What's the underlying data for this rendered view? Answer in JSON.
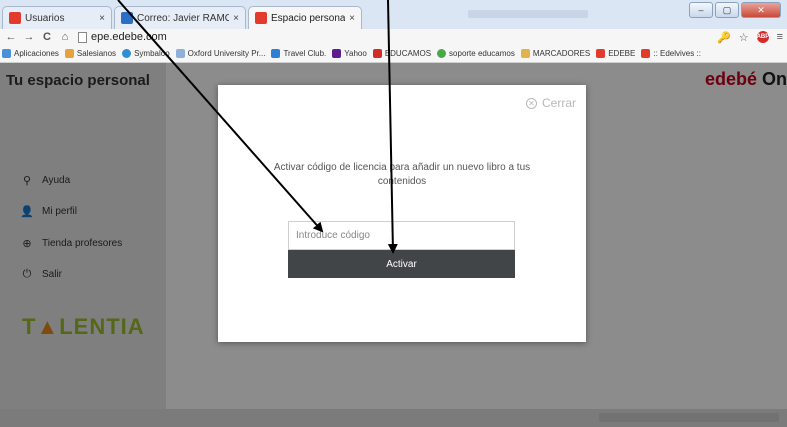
{
  "browser": {
    "tabs": [
      {
        "title": "Usuarios",
        "close": "×",
        "favicon_color": "#e23b2e"
      },
      {
        "title": "Correo: Javier RAMOS FE",
        "close": "×",
        "favicon_color": "#2d6fc4"
      },
      {
        "title": "Espacio personal Edebé",
        "close": "×",
        "favicon_color": "#e23b2e"
      }
    ],
    "window_buttons": [
      "–",
      "▢",
      "✕"
    ],
    "url": "epe.edebe.com",
    "adblock_label": "ABP",
    "bookmarks": [
      {
        "label": "Aplicaciones",
        "color": "#4a90d9"
      },
      {
        "label": "Salesianos",
        "color": "#e8a23a"
      },
      {
        "label": "Symbaloo",
        "color": "#2f8fd6"
      },
      {
        "label": "Oxford University Pr...",
        "color": "#8fb0d8"
      },
      {
        "label": "Travel Club.",
        "color": "#2f7fd6"
      },
      {
        "label": "Yahoo",
        "color": "#5c1d91"
      },
      {
        "label": "EDUCAMOS",
        "color": "#d42a2a"
      },
      {
        "label": "soporte educamos",
        "color": "#4aa84a"
      },
      {
        "label": "MARCADORES",
        "color": "#e0b44a"
      },
      {
        "label": "EDEBE",
        "color": "#e23b2e"
      },
      {
        "label": ":: Edelvives ::",
        "color": "#e23b2e"
      }
    ]
  },
  "page": {
    "brand": "Tu espacio personal",
    "logo": {
      "text": "edebé",
      "suffix": "On"
    },
    "sidebar": {
      "items": [
        {
          "label": "Ayuda",
          "icon": "help-icon"
        },
        {
          "label": "Mi perfil",
          "icon": "user-icon"
        },
        {
          "label": "Tienda profesores",
          "icon": "globe-icon"
        },
        {
          "label": "Salir",
          "icon": "power-icon"
        }
      ],
      "talentia": {
        "before": "T",
        "a": "▲",
        "after": "LENTIA"
      }
    }
  },
  "modal": {
    "close_label": "Cerrar",
    "message": "Activar código de licencia para añadir un nuevo libro a tus contenidos",
    "input_placeholder": "Introduce código",
    "input_value": "",
    "button_label": "Activar"
  },
  "colors": {
    "brand_red": "#c7001a",
    "button_dark": "#414548",
    "overlay": "rgba(0,0,0,0.45)"
  }
}
